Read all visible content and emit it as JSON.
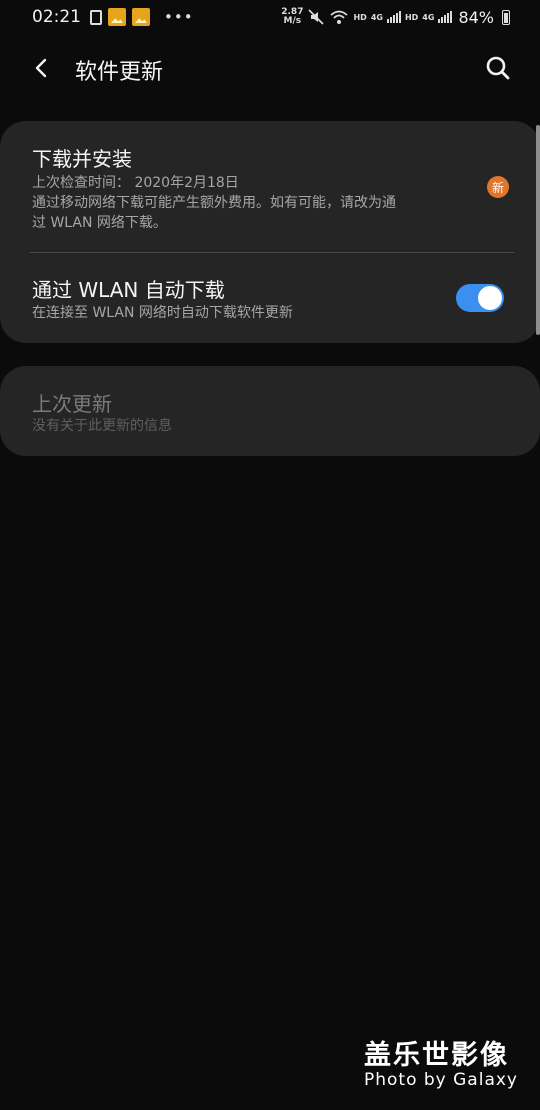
{
  "status_bar": {
    "time": "02:21",
    "speed_value": "2.87",
    "speed_unit": "M/s",
    "hd_1": "HD",
    "net_1": "4G",
    "hd_2": "HD",
    "net_2": "4G",
    "battery": "84%",
    "icons": [
      "doc-icon",
      "image-icon",
      "image-icon",
      "more-dots-icon",
      "mute-icon",
      "wifi-icon",
      "signal-icon",
      "battery-icon"
    ]
  },
  "header": {
    "title": "软件更新",
    "back_icon": "back-arrow-icon",
    "search_icon": "search-icon"
  },
  "download_section": {
    "title": "下载并安装",
    "last_check": "上次检查时间： 2020年2月18日",
    "note_line1": "通过移动网络下载可能产生额外费用。如有可能，请改为通",
    "note_line2": "过 WLAN 网络下载。",
    "badge": "新",
    "badge_color": "#e2752c"
  },
  "auto_download": {
    "title": "通过 WLAN 自动下载",
    "subtitle": "在连接至 WLAN 网络时自动下载软件更新",
    "enabled": true,
    "toggle_color": "#3a8ff0"
  },
  "last_update": {
    "title": "上次更新",
    "subtitle": "没有关于此更新的信息"
  },
  "watermark": {
    "line1": "盖乐世影像",
    "line2": "Photo by Galaxy"
  }
}
